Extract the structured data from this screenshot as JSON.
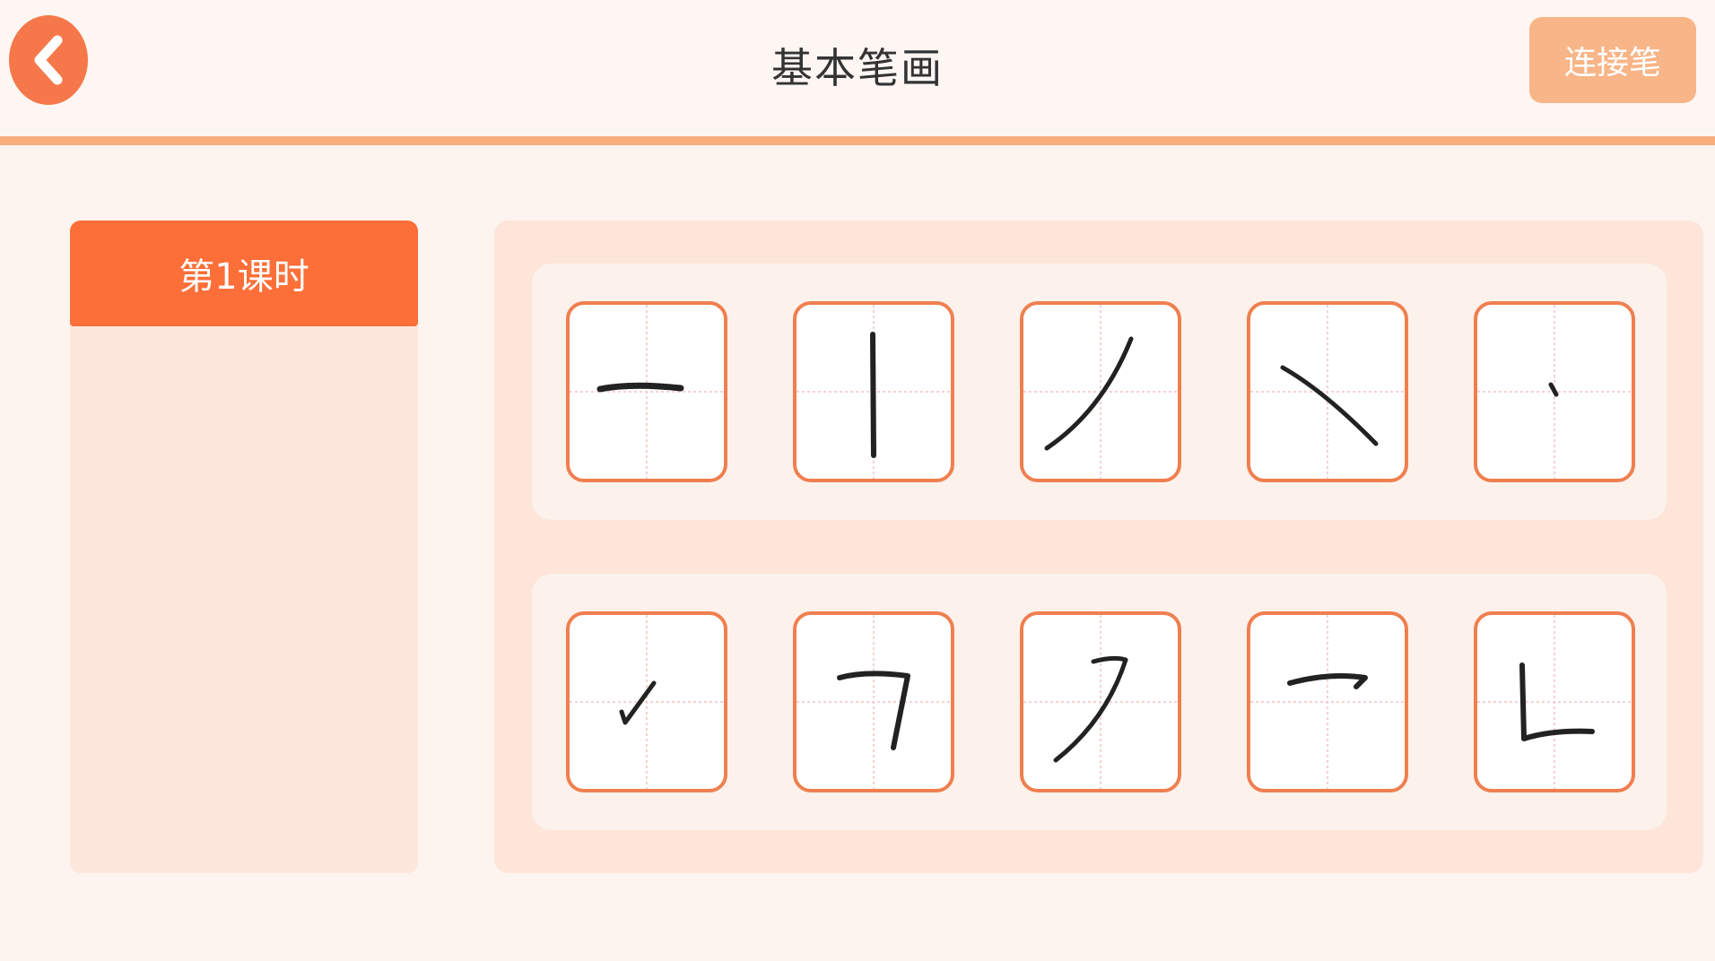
{
  "header": {
    "title": "基本笔画",
    "back_icon": "chevron-left-icon",
    "connect_label": "连接笔"
  },
  "sidebar": {
    "items": [
      {
        "label": "第1课时",
        "selected": true
      }
    ]
  },
  "strokes": [
    {
      "name": "heng-stroke"
    },
    {
      "name": "shu-stroke"
    },
    {
      "name": "pie-stroke"
    },
    {
      "name": "na-stroke"
    },
    {
      "name": "dian-stroke"
    },
    {
      "name": "ti-stroke"
    },
    {
      "name": "hengzhe-stroke"
    },
    {
      "name": "hengpie-stroke"
    },
    {
      "name": "henggou-stroke"
    },
    {
      "name": "shuzhe-stroke"
    }
  ],
  "colors": {
    "accent": "#fc6f38",
    "back_button": "#f6784a",
    "connect_button": "#f8b587",
    "card_border": "#ef7f4f",
    "divider": "#f7ad7c"
  }
}
